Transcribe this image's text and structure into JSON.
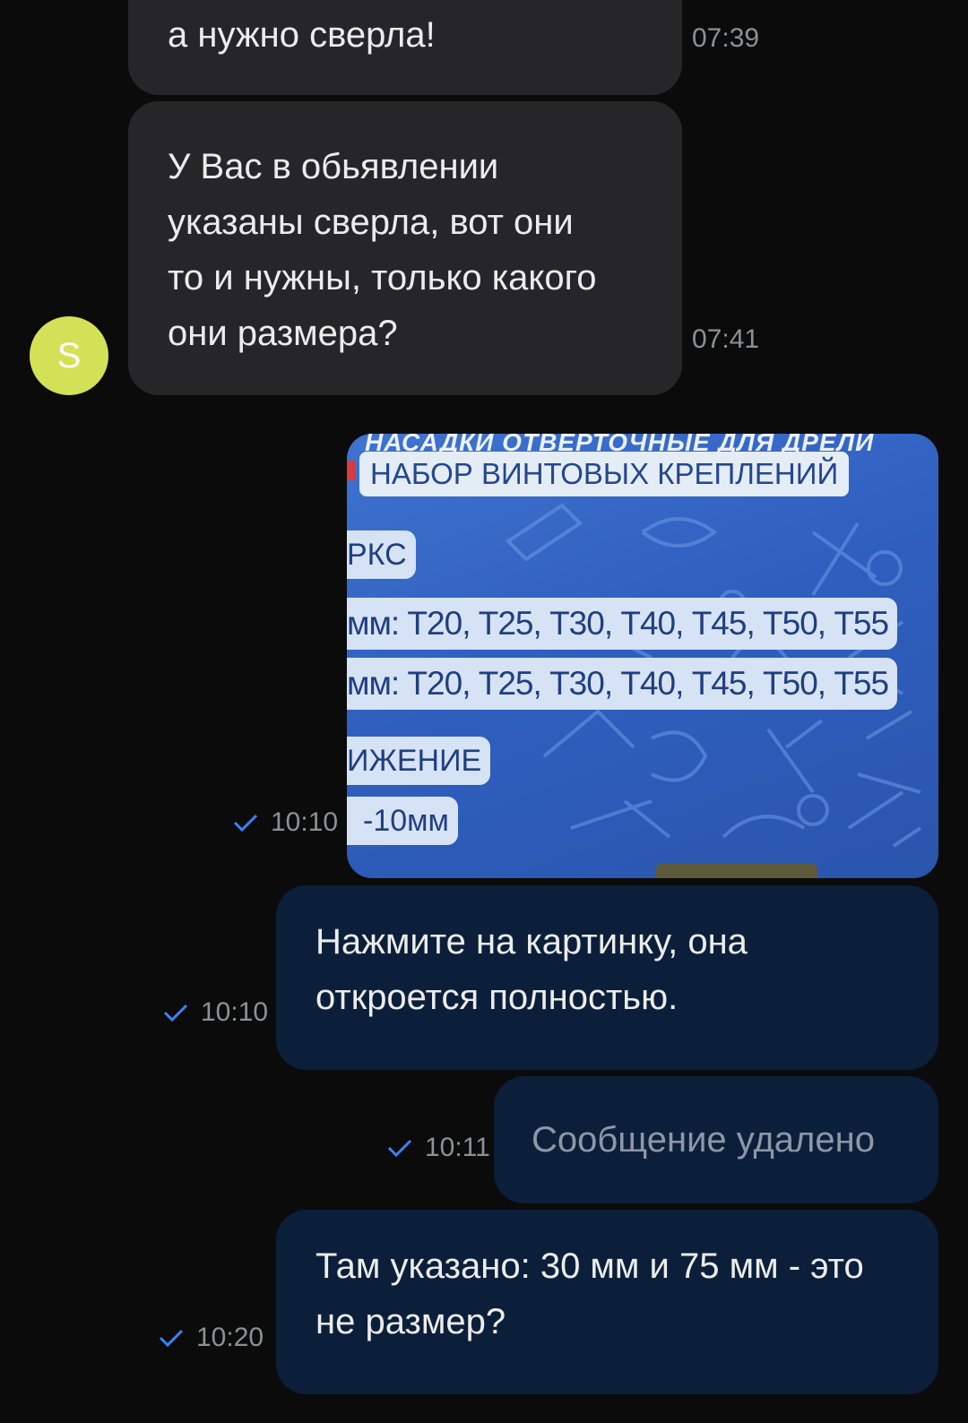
{
  "contact": {
    "avatar_initial": "S",
    "avatar_color": "#d4e157"
  },
  "messages": [
    {
      "direction": "incoming",
      "text": "а нужно сверла!",
      "time": "07:39"
    },
    {
      "direction": "incoming",
      "text": "У Вас в обьявлении\nуказаны сверла, вот они\nто и нужны, только какого\nони размера?",
      "time": "07:41"
    },
    {
      "direction": "outgoing",
      "type": "image",
      "time": "10:10",
      "status": "sent",
      "image_text": {
        "header_top": "НАСАДКИ ОТВЕРТОЧНЫЕ ДЛЯ ДРЕЛИ",
        "header": "НАБОР ВИНТОВЫХ КРЕПЛЕНИЙ",
        "chip1": "РКС",
        "line1": "мм: Т20, Т25, Т30, Т40, Т45, Т50, Т55",
        "line2": "мм: Т20, Т25, Т30, Т40, Т45, Т50, Т55",
        "chip2": "ИЖЕНИЕ",
        "chip3": "-10мм"
      }
    },
    {
      "direction": "outgoing",
      "text": "Нажмите на картинку, она\nоткроется полностью.",
      "time": "10:10",
      "status": "sent"
    },
    {
      "direction": "outgoing",
      "text": "Сообщение удалено",
      "time": "10:11",
      "status": "sent",
      "deleted": true
    },
    {
      "direction": "outgoing",
      "text": "Там указано: 30 мм и 75 мм - это\nне размер?",
      "time": "10:20",
      "status": "sent"
    }
  ],
  "colors": {
    "background": "#0b0b0c",
    "incoming_bubble": "#262628",
    "outgoing_bubble": "#0c1f3a",
    "check_mark": "#3b82f6"
  }
}
